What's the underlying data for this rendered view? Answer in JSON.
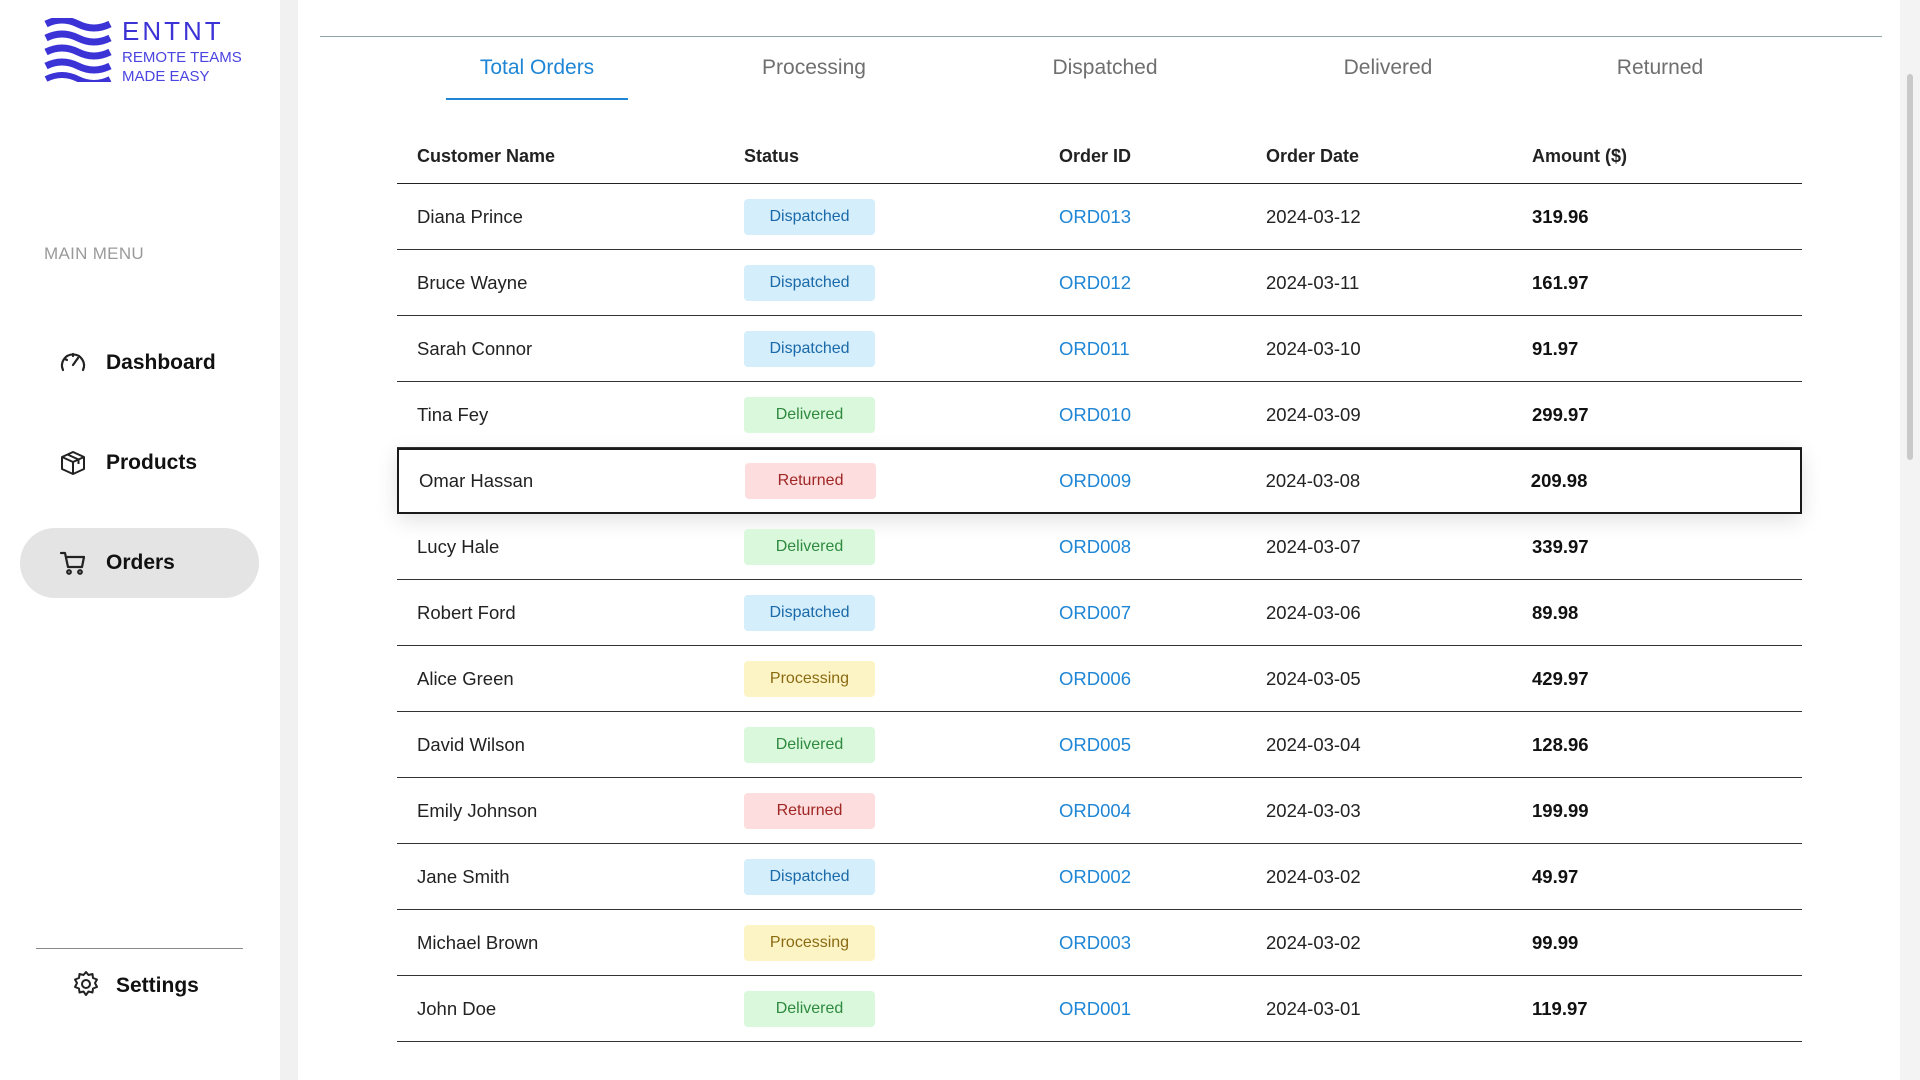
{
  "brand": {
    "name": "ENTNT",
    "tagline_line1": "REMOTE TEAMS",
    "tagline_line2": "MADE EASY",
    "color": "#3b33d6"
  },
  "sidebar": {
    "menu_label": "MAIN MENU",
    "items": [
      {
        "label": "Dashboard",
        "icon": "gauge-icon",
        "active": false
      },
      {
        "label": "Products",
        "icon": "box-icon",
        "active": false
      },
      {
        "label": "Orders",
        "icon": "cart-icon",
        "active": true
      }
    ],
    "settings_label": "Settings"
  },
  "tabs": [
    {
      "label": "Total Orders",
      "active": true
    },
    {
      "label": "Processing",
      "active": false
    },
    {
      "label": "Dispatched",
      "active": false
    },
    {
      "label": "Delivered",
      "active": false
    },
    {
      "label": "Returned",
      "active": false
    }
  ],
  "table": {
    "headers": [
      "Customer Name",
      "Status",
      "Order ID",
      "Order Date",
      "Amount ($)"
    ],
    "rows": [
      {
        "customer": "Diana Prince",
        "status": "Dispatched",
        "order_id": "ORD013",
        "date": "2024-03-12",
        "amount": "319.96"
      },
      {
        "customer": "Bruce Wayne",
        "status": "Dispatched",
        "order_id": "ORD012",
        "date": "2024-03-11",
        "amount": "161.97"
      },
      {
        "customer": "Sarah Connor",
        "status": "Dispatched",
        "order_id": "ORD011",
        "date": "2024-03-10",
        "amount": "91.97"
      },
      {
        "customer": "Tina Fey",
        "status": "Delivered",
        "order_id": "ORD010",
        "date": "2024-03-09",
        "amount": "299.97"
      },
      {
        "customer": "Omar Hassan",
        "status": "Returned",
        "order_id": "ORD009",
        "date": "2024-03-08",
        "amount": "209.98"
      },
      {
        "customer": "Lucy Hale",
        "status": "Delivered",
        "order_id": "ORD008",
        "date": "2024-03-07",
        "amount": "339.97"
      },
      {
        "customer": "Robert Ford",
        "status": "Dispatched",
        "order_id": "ORD007",
        "date": "2024-03-06",
        "amount": "89.98"
      },
      {
        "customer": "Alice Green",
        "status": "Processing",
        "order_id": "ORD006",
        "date": "2024-03-05",
        "amount": "429.97"
      },
      {
        "customer": "David Wilson",
        "status": "Delivered",
        "order_id": "ORD005",
        "date": "2024-03-04",
        "amount": "128.96"
      },
      {
        "customer": "Emily Johnson",
        "status": "Returned",
        "order_id": "ORD004",
        "date": "2024-03-03",
        "amount": "199.99"
      },
      {
        "customer": "Jane Smith",
        "status": "Dispatched",
        "order_id": "ORD002",
        "date": "2024-03-02",
        "amount": "49.97"
      },
      {
        "customer": "Michael Brown",
        "status": "Processing",
        "order_id": "ORD003",
        "date": "2024-03-02",
        "amount": "99.99"
      },
      {
        "customer": "John Doe",
        "status": "Delivered",
        "order_id": "ORD001",
        "date": "2024-03-01",
        "amount": "119.97"
      }
    ]
  },
  "colors": {
    "accent": "#1f86d6",
    "dispatched": "#d5eefc",
    "delivered": "#d9f8dc",
    "returned": "#fddddd",
    "processing": "#fdf4c5"
  }
}
